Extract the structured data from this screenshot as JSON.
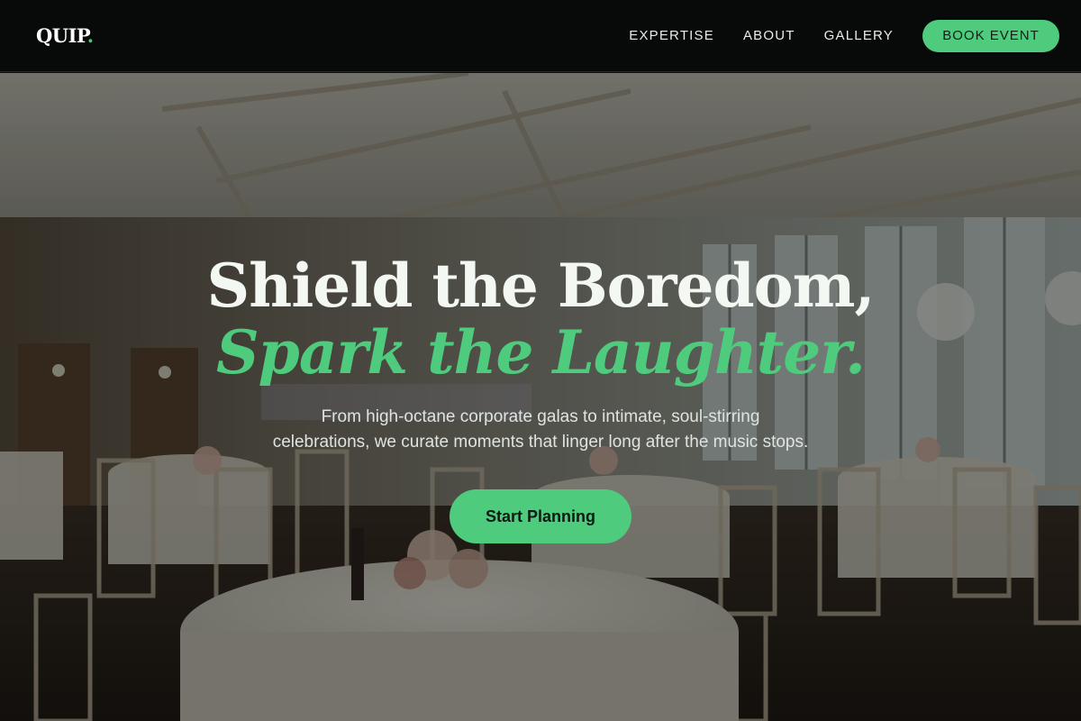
{
  "nav": {
    "logo_text": "QUIP",
    "logo_dot": ".",
    "links": [
      "EXPERTISE",
      "ABOUT",
      "GALLERY"
    ],
    "cta_label": "BOOK EVENT"
  },
  "hero": {
    "title_line1": "Shield the Boredom,",
    "title_line2": "Spark the Laughter.",
    "subtitle_line1": "From high-octane corporate galas to intimate, soul-stirring",
    "subtitle_line2": "celebrations, we curate moments that linger long after the music stops.",
    "cta_label": "Start Planning"
  },
  "colors": {
    "accent": "#4fcb7e",
    "nav_bg": "#080a09",
    "title_white": "#f4f8f2"
  }
}
